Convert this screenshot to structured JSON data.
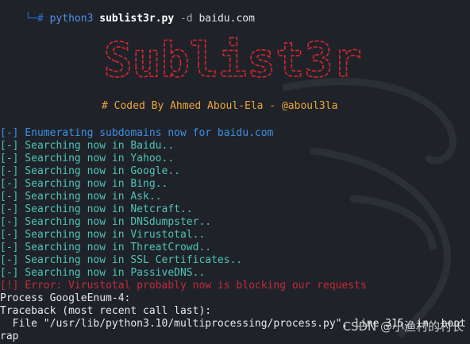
{
  "prompt": {
    "corner": "└─#",
    "command": "python3",
    "script": "sublist3r.py",
    "flag": "-d",
    "target": "baidu.com"
  },
  "banner_text": "Sublist3r",
  "coded_by": "# Coded By Ahmed Aboul-Ela - @aboul3la",
  "output": {
    "enumerating": "[-] Enumerating subdomains now for baidu.com",
    "searching": [
      "[-] Searching now in Baidu..",
      "[-] Searching now in Yahoo..",
      "[-] Searching now in Google..",
      "[-] Searching now in Bing..",
      "[-] Searching now in Ask..",
      "[-] Searching now in Netcraft..",
      "[-] Searching now in DNSdumpster..",
      "[-] Searching now in Virustotal..",
      "[-] Searching now in ThreatCrowd..",
      "[-] Searching now in SSL Certificates..",
      "[-] Searching now in PassiveDNS.."
    ],
    "error": "[!] Error: Virustotal probably now is blocking our requests",
    "process": "Process GoogleEnum-4:",
    "traceback": "Traceback (most recent call last):",
    "file_line": "  File \"/usr/lib/python3.10/multiprocessing/process.py\", line 315, in _boot",
    "last_line": "rap"
  },
  "watermark": "CSDN @小渔村的村长",
  "colors": {
    "background": "#1f2329",
    "enum": "#3c8fe6",
    "search": "#4fc3b8",
    "error": "#c22a3a",
    "banner": "#d9262f",
    "coded_by": "#e9a53b"
  }
}
